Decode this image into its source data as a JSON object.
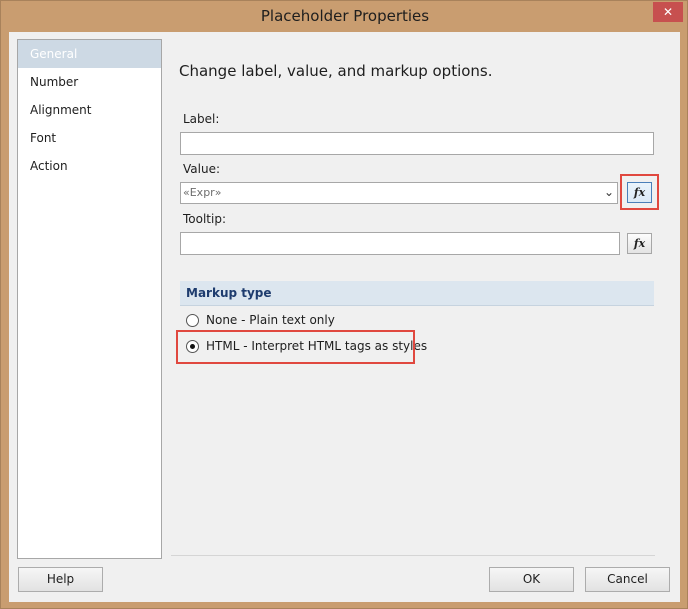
{
  "window": {
    "title": "Placeholder Properties",
    "close_glyph": "✕"
  },
  "nav": {
    "items": [
      {
        "label": "General",
        "selected": true
      },
      {
        "label": "Number",
        "selected": false
      },
      {
        "label": "Alignment",
        "selected": false
      },
      {
        "label": "Font",
        "selected": false
      },
      {
        "label": "Action",
        "selected": false
      }
    ]
  },
  "main": {
    "heading": "Change label, value, and markup options.",
    "label_field": {
      "label": "Label:",
      "value": ""
    },
    "value_field": {
      "label": "Value:",
      "value": "«Expr»",
      "arrow": "⌄"
    },
    "tooltip_field": {
      "label": "Tooltip:",
      "value": ""
    },
    "fx_glyph": "fx",
    "markup": {
      "header": "Markup type",
      "options": [
        {
          "label": "None - Plain text only",
          "checked": false
        },
        {
          "label": "HTML - Interpret HTML tags as styles",
          "checked": true
        }
      ]
    }
  },
  "footer": {
    "help": "Help",
    "ok": "OK",
    "cancel": "Cancel"
  },
  "colors": {
    "accent_highlight": "#e0483f",
    "frame": "#c99d70",
    "close": "#c7504f"
  }
}
